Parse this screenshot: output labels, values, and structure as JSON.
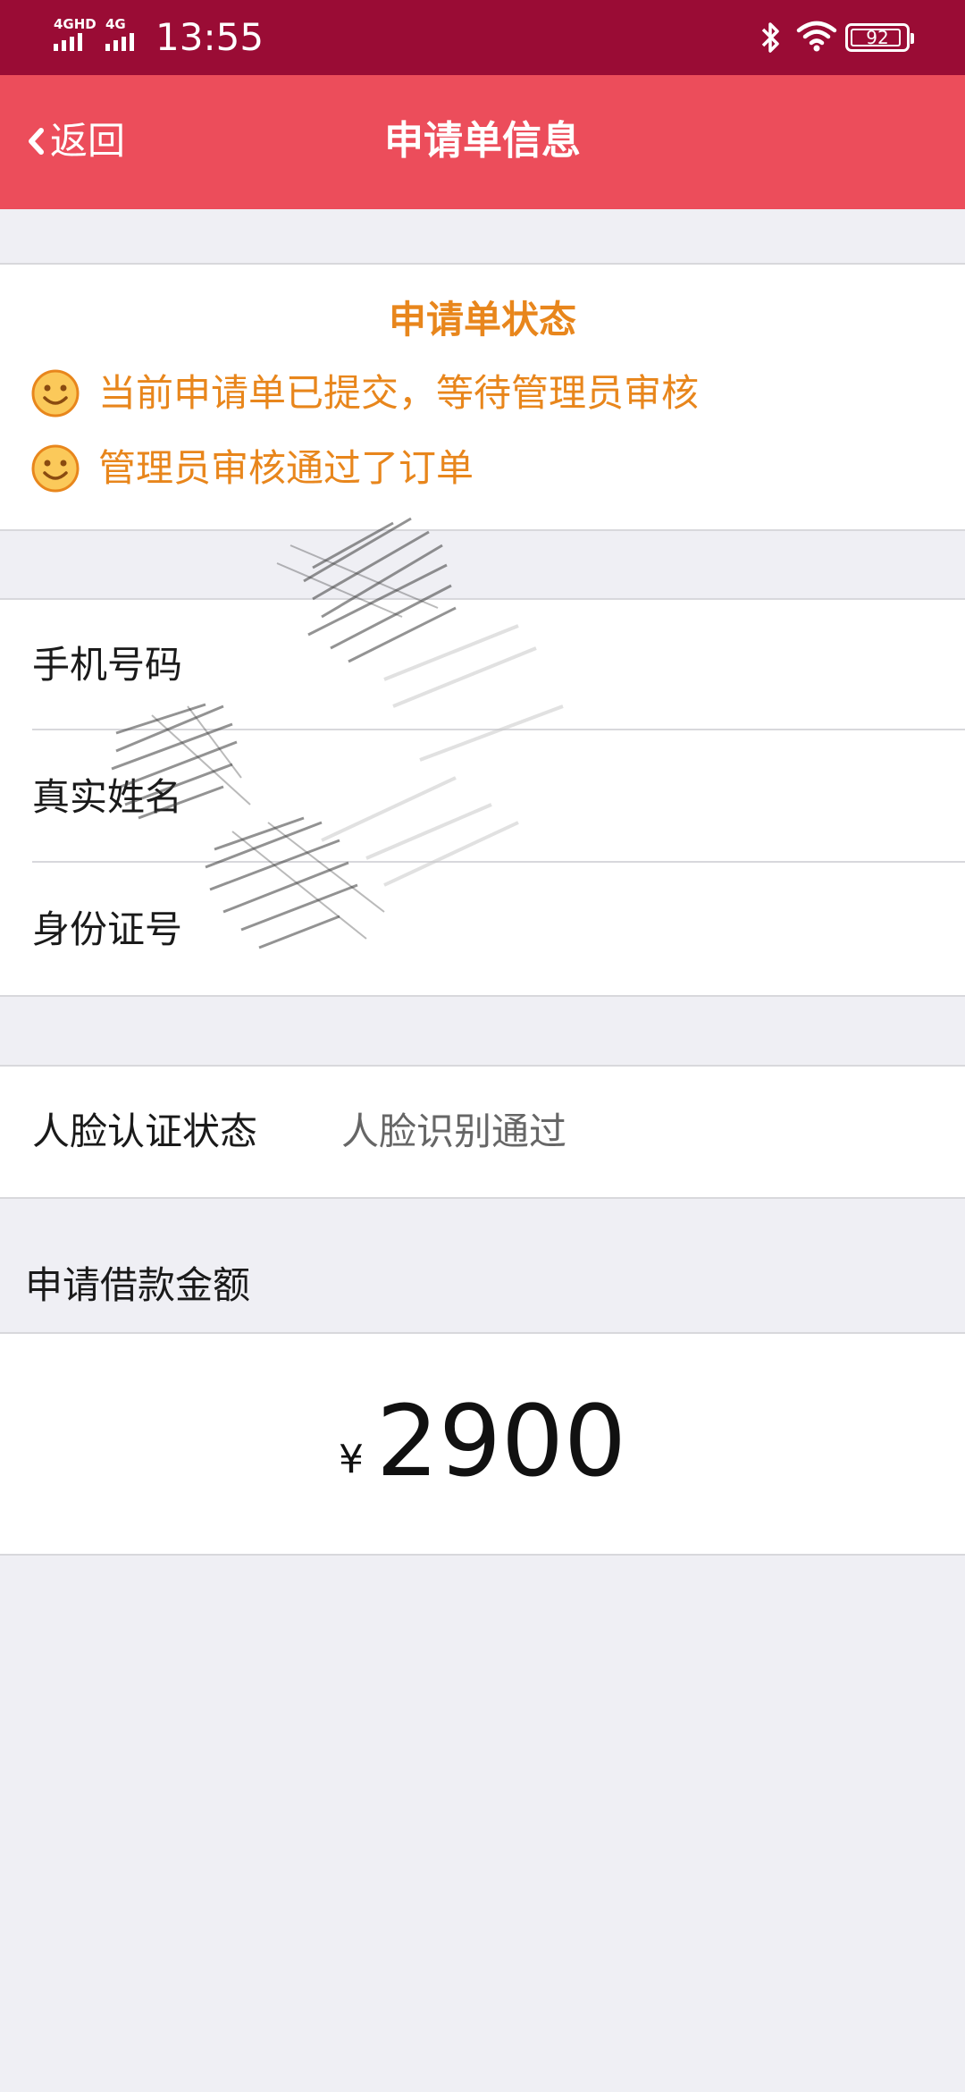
{
  "status_bar": {
    "net1": "4GHD",
    "net2": "4G",
    "time": "13:55",
    "battery": "92",
    "icons": [
      "signal-icon",
      "bluetooth-icon",
      "wifi-icon",
      "battery-icon"
    ]
  },
  "nav": {
    "back_label": "返回",
    "title": "申请单信息",
    "bar_color": "#ec4d5b"
  },
  "status_card": {
    "title": "申请单状态",
    "items": [
      {
        "text": "当前申请单已提交，等待管理员审核",
        "icon": "smiley-icon"
      },
      {
        "text": "管理员审核通过了订单",
        "icon": "smiley-icon"
      }
    ],
    "accent": "#e8861c"
  },
  "info": {
    "phone_label": "手机号码",
    "name_label": "真实姓名",
    "id_label": "身份证号"
  },
  "face": {
    "label": "人脸认证状态",
    "value": "人脸识别通过"
  },
  "amount": {
    "section_label": "申请借款金额",
    "currency": "¥",
    "value": "2900"
  }
}
